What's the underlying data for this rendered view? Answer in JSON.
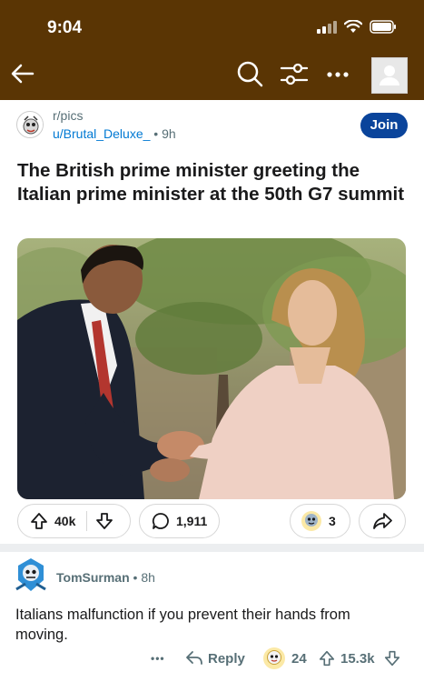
{
  "status_bar": {
    "time": "9:04",
    "icons": [
      "signal-icon",
      "wifi-icon",
      "battery-icon"
    ]
  },
  "nav": {
    "icons": [
      "back-arrow-icon",
      "search-icon",
      "filter-icon",
      "more-icon",
      "user-avatar"
    ]
  },
  "post": {
    "subreddit": "r/pics",
    "author": "u/Brutal_Deluxe_",
    "separator": "•",
    "age": "9h",
    "join_label": "Join",
    "title": "The British prime minister greeting the Italian prime minister at the 50th G7 summit",
    "upvotes": "40k",
    "comments": "1,911",
    "awards": "3"
  },
  "comment": {
    "user": "TomSurman",
    "separator": "•",
    "age": "8h",
    "body": "Italians malfunction if you prevent their hands from moving.",
    "more_label": "•••",
    "reply_label": "Reply",
    "awards": "24",
    "upvotes": "15.3k"
  },
  "colors": {
    "header_bg": "#5a3504",
    "join_bg": "#0a449b",
    "link_blue": "#0079d3",
    "meta_gray": "#576f76"
  }
}
